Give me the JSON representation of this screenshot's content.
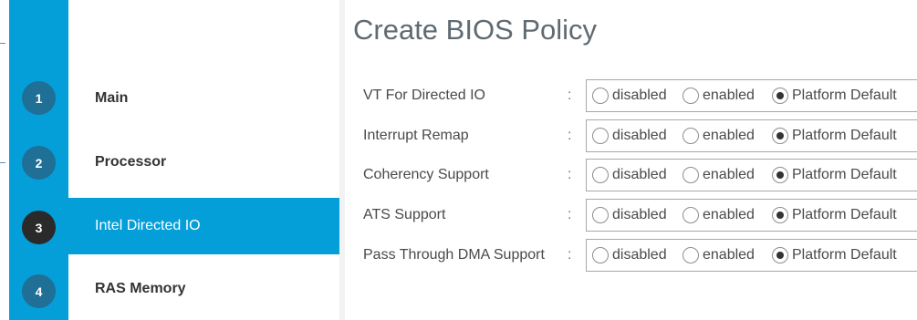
{
  "title": "Create BIOS Policy",
  "wizard": {
    "steps": [
      {
        "number": "1",
        "label": "Main"
      },
      {
        "number": "2",
        "label": "Processor"
      },
      {
        "number": "3",
        "label": "Intel Directed IO"
      },
      {
        "number": "4",
        "label": "RAS Memory"
      }
    ],
    "active_step": "3"
  },
  "form": {
    "options": {
      "disabled": "disabled",
      "enabled": "enabled",
      "platform_default": "Platform Default"
    },
    "rows": [
      {
        "label": "VT For Directed IO",
        "colon": ":",
        "selected": "Platform Default"
      },
      {
        "label": "Interrupt Remap",
        "colon": ":",
        "selected": "Platform Default"
      },
      {
        "label": "Coherency Support",
        "colon": ":",
        "selected": "Platform Default"
      },
      {
        "label": "ATS Support",
        "colon": ":",
        "selected": "Platform Default"
      },
      {
        "label": "Pass Through DMA Support",
        "colon": ":",
        "selected": "Platform Default"
      }
    ]
  },
  "colors": {
    "accent": "#049fd9",
    "step_circle": "#1f6f97",
    "step_circle_active": "#2a2a2a"
  }
}
